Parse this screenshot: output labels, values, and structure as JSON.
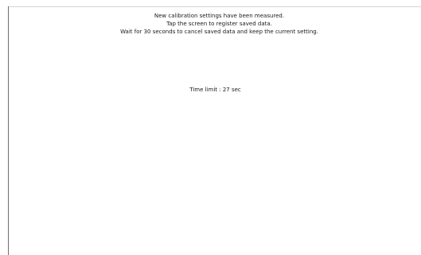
{
  "calibration": {
    "message_lines": [
      "New calibration settings have been measured.",
      "Tap the screen to register saved data.",
      "Wait for 30 seconds to cancel saved data and keep the current setting."
    ],
    "time_limit_text": "Time limit : 27 sec"
  },
  "colors": {
    "background": "#ffffff",
    "text": "#1a1a1a",
    "frame_line": "#6e6e6e"
  }
}
